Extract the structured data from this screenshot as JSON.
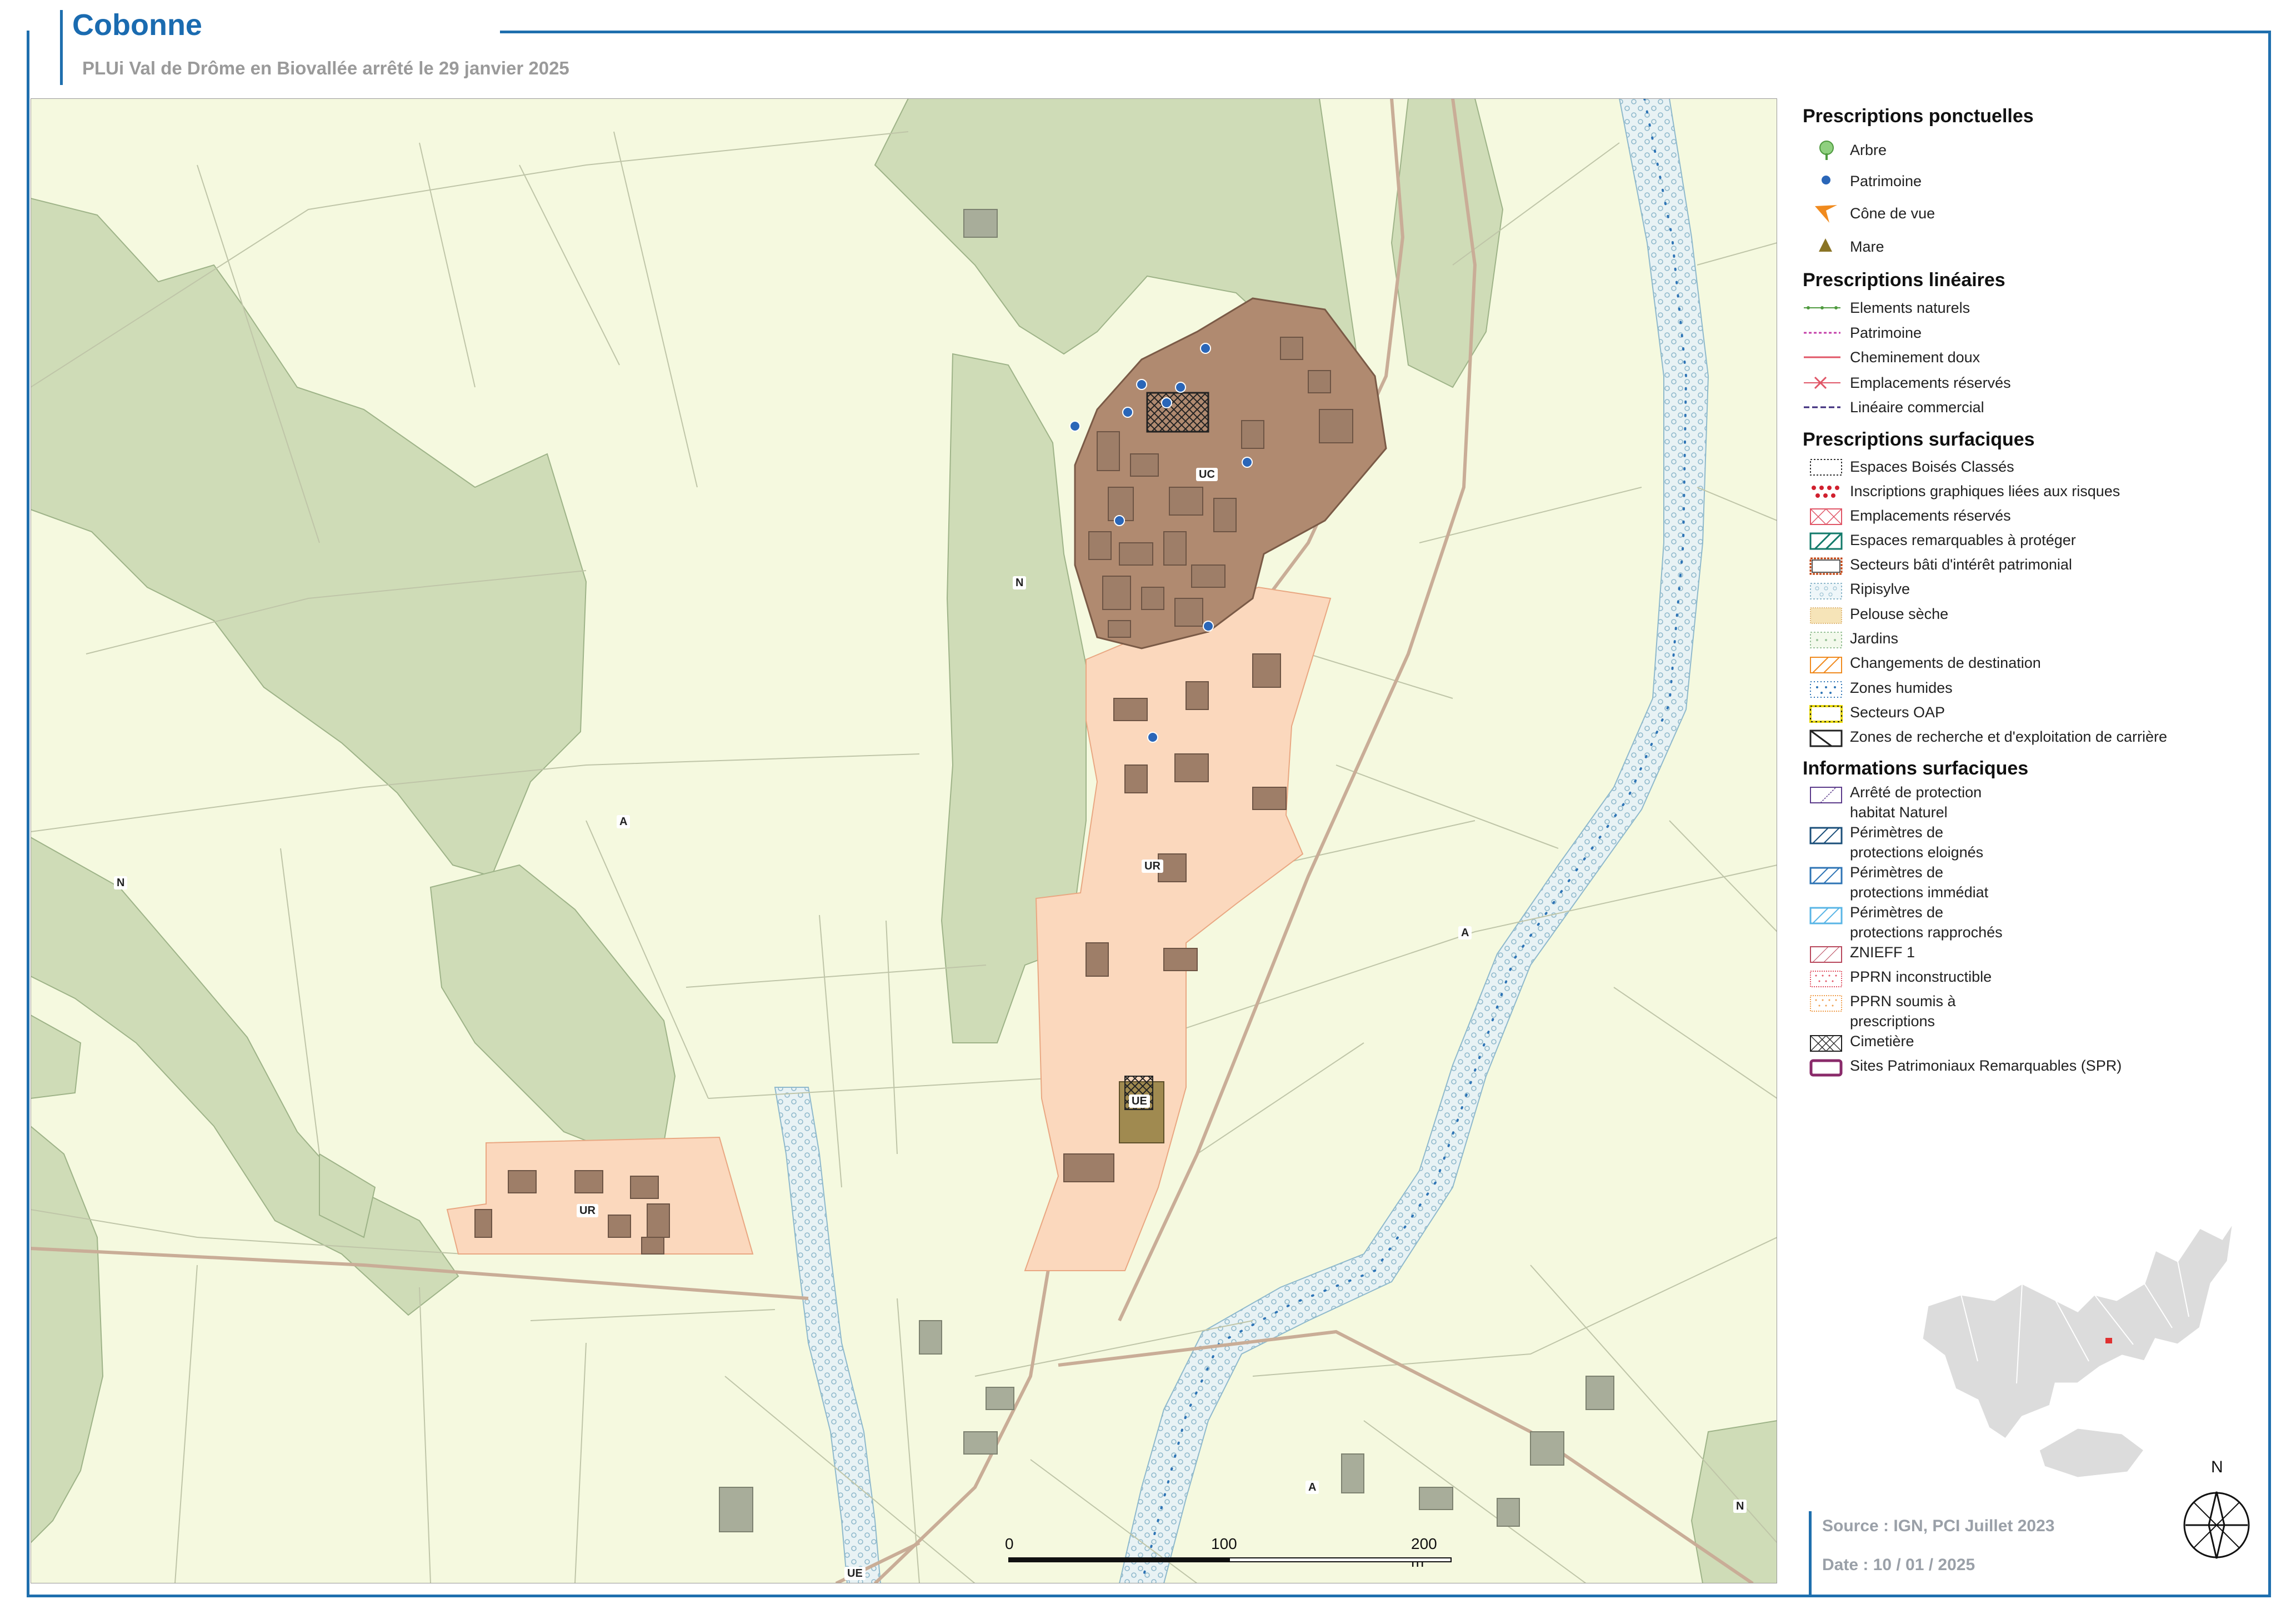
{
  "header": {
    "title": "Cobonne",
    "subtitle": "PLUi Val de Drôme en Biovallée arrêté le 29 janvier 2025"
  },
  "colors": {
    "brand": "#1f6fae",
    "background_plain": "#f5f9df",
    "forest": "#cfdcb7",
    "village_core": "#b08a70",
    "urban_zone": "#fbd8bd",
    "building": "#9e7e68",
    "river": "#e7f1f6"
  },
  "map": {
    "zone_labels": {
      "uc": "UC",
      "n_center": "N",
      "a_left": "A",
      "n_left": "N",
      "ur_center": "UR",
      "a_right": "A",
      "ur_left": "UR",
      "ue_center": "UE",
      "a_bottom": "A",
      "n_bottom_right": "N",
      "ue_bottom": "UE"
    }
  },
  "legend": {
    "ponctuelles": {
      "title": "Prescriptions ponctuelles",
      "items": [
        {
          "label": "Arbre",
          "icon": "tree-icon"
        },
        {
          "label": "Patrimoine",
          "icon": "heritage-dot-icon"
        },
        {
          "label": "Cône de vue",
          "icon": "view-cone-icon"
        },
        {
          "label": "Mare",
          "icon": "pond-triangle-icon"
        }
      ]
    },
    "lineaires": {
      "title": "Prescriptions linéaires",
      "items": [
        {
          "label": "Elements naturels",
          "icon": "green-dotted-line-icon"
        },
        {
          "label": "Patrimoine",
          "icon": "magenta-dashed-line-icon"
        },
        {
          "label": "Cheminement doux",
          "icon": "red-line-icon"
        },
        {
          "label": "Emplacements réservés",
          "icon": "red-cross-line-icon"
        },
        {
          "label": "Linéaire commercial",
          "icon": "purple-dashed-line-icon"
        }
      ]
    },
    "surfaciques": {
      "title": "Prescriptions surfaciques",
      "items": [
        {
          "label": "Espaces Boisés Classés",
          "icon": "ebc-swatch-icon"
        },
        {
          "label": "Inscriptions graphiques liées aux risques",
          "icon": "risk-dots-swatch-icon"
        },
        {
          "label": "Emplacements réservés",
          "icon": "reserved-cross-swatch-icon"
        },
        {
          "label": "Espaces remarquables à protéger",
          "icon": "remarkable-hatch-swatch-icon"
        },
        {
          "label": "Secteurs bâti d'intérêt patrimonial",
          "icon": "heritage-area-swatch-icon"
        },
        {
          "label": "Ripisylve",
          "icon": "ripisylve-swatch-icon"
        },
        {
          "label": "Pelouse sèche",
          "icon": "dry-lawn-swatch-icon"
        },
        {
          "label": "Jardins",
          "icon": "garden-swatch-icon"
        },
        {
          "label": "Changements de destination",
          "icon": "destination-change-swatch-icon"
        },
        {
          "label": "Zones humides",
          "icon": "wetland-swatch-icon"
        },
        {
          "label": "Secteurs OAP",
          "icon": "oap-swatch-icon"
        },
        {
          "label": "Zones de recherche et d'exploitation de carrière",
          "icon": "quarry-swatch-icon"
        }
      ]
    },
    "informations": {
      "title": "Informations surfaciques",
      "items": [
        {
          "label": "Arrêté de protection",
          "label2": "habitat Naturel",
          "icon": "habitat-swatch-icon"
        },
        {
          "label": "Périmètres de",
          "label2": "protections eloignés",
          "icon": "far-perimeter-swatch-icon"
        },
        {
          "label": "Périmètres de",
          "label2": "protections immédiat",
          "icon": "immediate-perimeter-swatch-icon"
        },
        {
          "label": "Périmètres de",
          "label2": "protections rapprochés",
          "icon": "close-perimeter-swatch-icon"
        },
        {
          "label": "ZNIEFF 1",
          "icon": "znieff-swatch-icon"
        },
        {
          "label": "PPRN inconstructible",
          "icon": "pprn-red-swatch-icon"
        },
        {
          "label": "PPRN soumis à",
          "label2": "prescriptions",
          "icon": "pprn-orange-swatch-icon"
        },
        {
          "label": "Cimetière",
          "icon": "cemetery-swatch-icon"
        },
        {
          "label": "Sites Patrimoniaux Remarquables (SPR)",
          "icon": "spr-swatch-icon"
        }
      ]
    }
  },
  "scale": {
    "t0": "0",
    "t1": "100",
    "t2": "200 m"
  },
  "north": {
    "label": "N"
  },
  "footer": {
    "source": "Source : IGN, PCI Juillet 2023",
    "date": "Date : 10 / 01 / 2025"
  }
}
